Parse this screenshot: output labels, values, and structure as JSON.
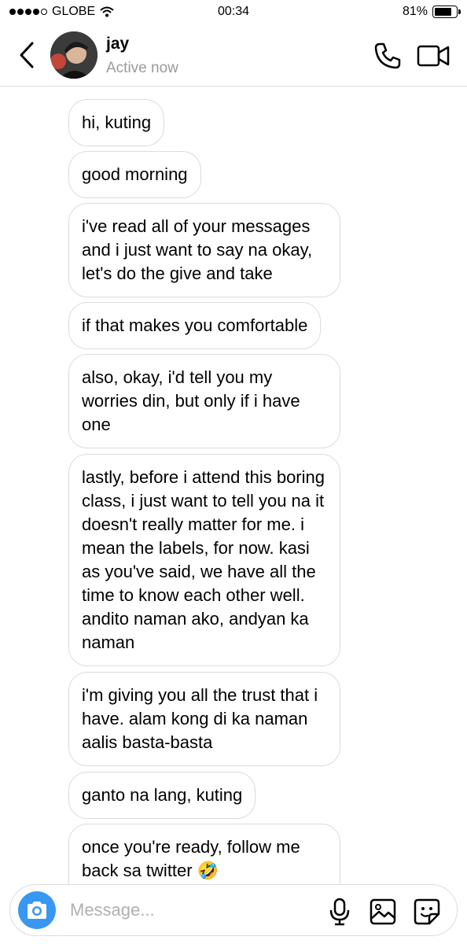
{
  "status_bar": {
    "carrier": "GLOBE",
    "time": "00:34",
    "battery_percent": "81%",
    "battery_level": 0.81,
    "signal_bars": 4,
    "signal_max": 5
  },
  "header": {
    "contact_name": "jay",
    "contact_status": "Active now",
    "icons": [
      "back-chevron-icon",
      "phone-icon",
      "video-camera-icon"
    ]
  },
  "messages": [
    {
      "text": "hi, kuting"
    },
    {
      "text": "good morning"
    },
    {
      "text": "i've read all of your messages and i just want to say na okay, let's do the give and take"
    },
    {
      "text": "if that makes you comfortable"
    },
    {
      "text": "also, okay, i'd tell you my worries din, but only if i have one"
    },
    {
      "text": "lastly, before i attend this boring class, i just want to tell you na it doesn't really matter for me. i mean the labels, for now. kasi as you've said, we have all the time to know each other well. andito naman ako, andyan ka naman"
    },
    {
      "text": "i'm giving you all the trust that i have. alam kong di ka naman aalis basta-basta"
    },
    {
      "text": "ganto na lang, kuting"
    },
    {
      "text": "once you're ready, follow me back sa twitter 🤣"
    }
  ],
  "composer": {
    "placeholder": "Message...",
    "value": "",
    "icons": [
      "camera-icon",
      "microphone-icon",
      "gallery-icon",
      "sticker-icon"
    ]
  },
  "colors": {
    "accent_blue": "#3897f0",
    "secondary_text": "#9a9a9a",
    "border": "#dcdcdc"
  }
}
